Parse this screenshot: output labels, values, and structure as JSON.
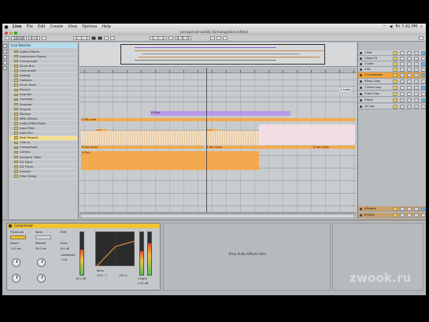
{
  "menubar": {
    "app": "Live",
    "items": [
      "File",
      "Edit",
      "Create",
      "View",
      "Options",
      "Help"
    ],
    "clock": "Fri 7:42 PM"
  },
  "window": {
    "title": "peruperad-sollab [Schungadsd solfab]"
  },
  "transport": {
    "tempo": "120.00",
    "meter": "4 / 4",
    "position": "1 . 1 . 1",
    "loop": "1 . 1 . 1",
    "length": "4 . 0 . 0"
  },
  "browser": {
    "header": "Live Devices",
    "items": [
      "Audio Effects",
      "Instrument Racks",
      "Compressor",
      "Drum Bus",
      "Instrument",
      "Analog",
      "Collision",
      "Drum Rack",
      "Electric",
      "Impulse",
      "Operator",
      "Sampler",
      "Simpler",
      "Tension",
      "MIDI Effects",
      "Audio Effect Rack",
      "Auto Filter",
      "Auto Pan",
      "Beat Repeat",
      "Chorus",
      "Compressor",
      "Corpus",
      "Dynamic Tube",
      "EQ Eight",
      "EQ Three",
      "Erosion",
      "Filter Delay"
    ],
    "selected_index": 18
  },
  "arrangement": {
    "clips": [
      {
        "track": 0,
        "label": "6 Bass",
        "color": "#b79ae9"
      },
      {
        "track": 2,
        "label": "3 Mk Lead",
        "color": "#f3a94d"
      },
      {
        "track": 3,
        "label": "4 Fx",
        "color": "#f3a94d"
      },
      {
        "track": 3,
        "label": "4 Fx",
        "color": "#f3a94d"
      },
      {
        "track": 3,
        "label": "4 Fx",
        "color": "#f3a94d"
      },
      {
        "track": 4,
        "label": "8 Vox Chop",
        "color": "#f3a94d"
      },
      {
        "track": 4,
        "label": "8 Vox Chop",
        "color": "#f3a94d"
      },
      {
        "track": 4,
        "label": "8 Vox Chop",
        "color": "#f3a94d"
      },
      {
        "track": 5,
        "label": "9 Pad",
        "color": "#f3a94d"
      }
    ],
    "side_label": "4 Audio"
  },
  "mixer": {
    "tracks": [
      {
        "name": "1 Pad",
        "state": "normal"
      },
      {
        "name": "2 Bass Fill",
        "state": "normal"
      },
      {
        "name": "3 Lead",
        "state": "normal"
      },
      {
        "name": "4 Kit",
        "state": "normal"
      },
      {
        "name": "5 Compressor",
        "state": "selected"
      },
      {
        "name": "6 Bass Loop",
        "state": "normal"
      },
      {
        "name": "7 Drum Loop",
        "state": "normal"
      },
      {
        "name": "8 Vox Chop",
        "state": "normal"
      },
      {
        "name": "9 Ride",
        "state": "normal"
      },
      {
        "name": "10 Clap",
        "state": "normal"
      },
      {
        "name": "A Reverb",
        "state": "return"
      },
      {
        "name": "B Delay",
        "state": "return"
      },
      {
        "name": "C Hat",
        "state": "return"
      },
      {
        "name": "Master",
        "state": "master"
      }
    ]
  },
  "device": {
    "name": "Compressor",
    "labels": [
      "Threshold",
      "Ratio",
      "Attack",
      "Release",
      "Output",
      "Dry/Wet",
      "Knee",
      "Lookahead",
      "Peak",
      "RMS",
      "Expand"
    ],
    "values": [
      "-18.2 dB",
      "4.00 : 1",
      "1.00 ms",
      "50.0 ms",
      "0.00 dB",
      "100 %",
      "6.0 dB",
      "1 ms"
    ],
    "gain_reduction_level": 0.55,
    "input_level": 0.6,
    "output_level": 0.75,
    "drop_hint": "Drop Audio Effects Here"
  },
  "watermark": "zwook.ru",
  "colors": {
    "clip_orange": "#f3a94d",
    "clip_purple": "#b79ae9",
    "selected_track": "#f0a43a",
    "return_track": "#c9a06b",
    "master_track": "#66aee0"
  }
}
